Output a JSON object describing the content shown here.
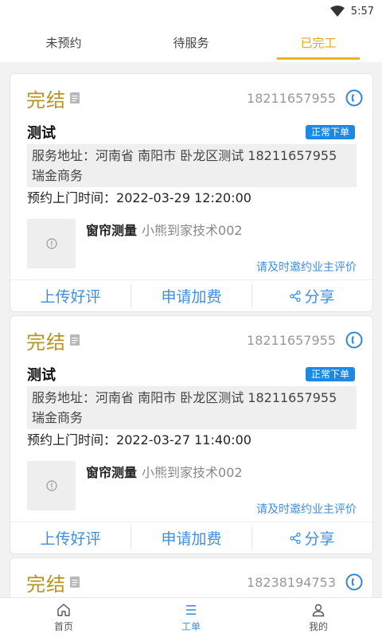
{
  "status_bar": {
    "time": "5:57"
  },
  "tabs": [
    {
      "label": "未预约",
      "active": false
    },
    {
      "label": "待服务",
      "active": false
    },
    {
      "label": "已完工",
      "active": true
    }
  ],
  "orders": [
    {
      "status": "完结",
      "phone": "18211657955",
      "title": "测试",
      "badge": "正常下单",
      "address_label": "服务地址：",
      "address": "河南省 南阳市 卧龙区测试 18211657955 瑞金商务",
      "time_label": "预约上门时间：",
      "time": "2022-03-29 12:20:00",
      "service_name": "窗帘测量",
      "technician": "小熊到家技术002",
      "eval_link": "请及时邀约业主评价",
      "actions": {
        "review": "上传好评",
        "fee": "申请加费",
        "share": "分享"
      }
    },
    {
      "status": "完结",
      "phone": "18211657955",
      "title": "测试",
      "badge": "正常下单",
      "address_label": "服务地址：",
      "address": "河南省 南阳市 卧龙区测试 18211657955 瑞金商务",
      "time_label": "预约上门时间：",
      "time": "2022-03-27 11:40:00",
      "service_name": "窗帘测量",
      "technician": "小熊到家技术002",
      "eval_link": "请及时邀约业主评价",
      "actions": {
        "review": "上传好评",
        "fee": "申请加费",
        "share": "分享"
      }
    },
    {
      "status": "完结",
      "phone": "18238194753"
    }
  ],
  "bottom_nav": [
    {
      "label": "首页",
      "icon": "home-icon",
      "active": false
    },
    {
      "label": "工单",
      "icon": "list-icon",
      "active": true
    },
    {
      "label": "我的",
      "icon": "user-icon",
      "active": false
    }
  ],
  "colors": {
    "status_gold": "#b5951a",
    "tab_active": "#e0a81c",
    "link_blue": "#3f8fe0",
    "badge_blue": "#1e88e5"
  }
}
